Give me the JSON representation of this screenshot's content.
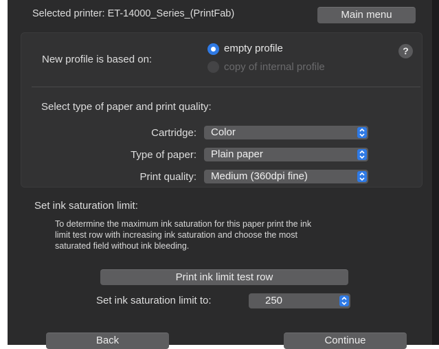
{
  "header": {
    "selected_printer": "Selected printer: ET-14000_Series_(PrintFab)",
    "main_menu_label": "Main menu"
  },
  "profile": {
    "based_on_label": "New profile is based on:",
    "options": [
      {
        "label": "empty profile",
        "selected": true,
        "enabled": true
      },
      {
        "label": "copy of internal profile",
        "selected": false,
        "enabled": false
      }
    ],
    "help_label": "?"
  },
  "paper_quality": {
    "section_label": "Select type of paper and print quality:",
    "cartridge_label": "Cartridge:",
    "cartridge_value": "Color",
    "paper_type_label": "Type of paper:",
    "paper_type_value": "Plain paper",
    "quality_label": "Print quality:",
    "quality_value": "Medium (360dpi fine)"
  },
  "ink": {
    "section_label": "Set ink saturation limit:",
    "description_lines": [
      "To determine the maximum ink saturation for this paper print the ink",
      "limit test row with increasing ink saturation and choose the most",
      "saturated field without ink bleeding."
    ],
    "print_button_label": "Print ink limit test row",
    "limit_label": "Set ink saturation limit to:",
    "limit_value": "250"
  },
  "footer": {
    "back_label": "Back",
    "continue_label": "Continue"
  },
  "colors": {
    "background": "#2b2b2c",
    "accent": "#2f7ae5",
    "button": "#5d5d5f"
  }
}
